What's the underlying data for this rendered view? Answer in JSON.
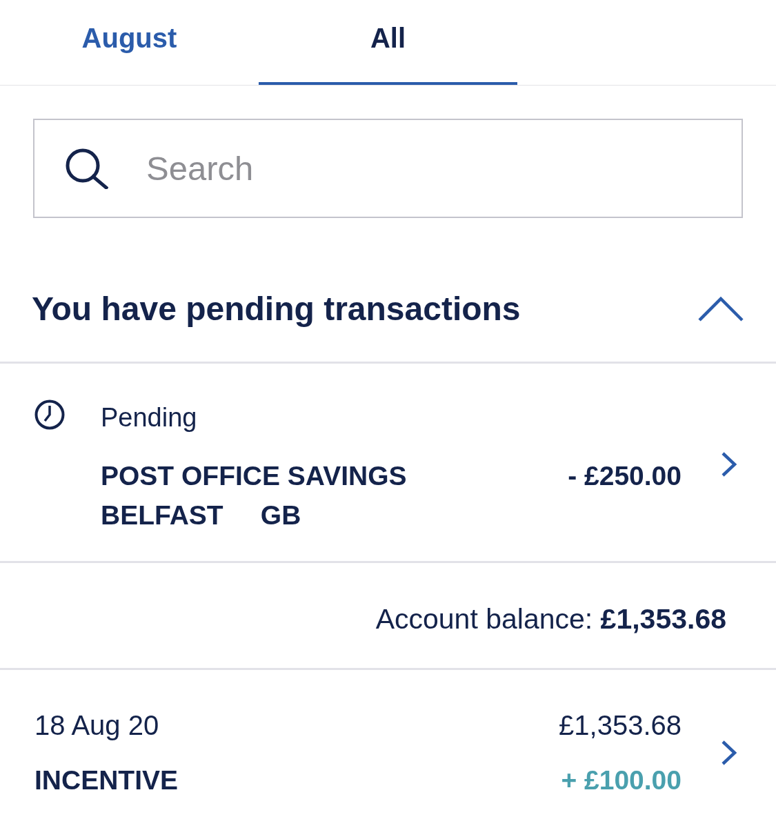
{
  "tabs": [
    {
      "label": "August",
      "selected": false
    },
    {
      "label": "All",
      "selected": true
    }
  ],
  "search": {
    "placeholder": "Search"
  },
  "pending_section": {
    "title": "You have pending transactions",
    "expanded": true,
    "items": [
      {
        "status": "Pending",
        "description_lines": [
          "POST OFFICE SAVINGS",
          "BELFAST     GB"
        ],
        "amount": "- £250.00"
      }
    ]
  },
  "account_balance": "Account balance: **£1,353.68**",
  "transactions": [
    {
      "date": "18 Aug 20",
      "balance": "£1,353.68",
      "description": "INCENTIVE",
      "amount": "+ £100.00",
      "kind": "credit"
    }
  ]
}
